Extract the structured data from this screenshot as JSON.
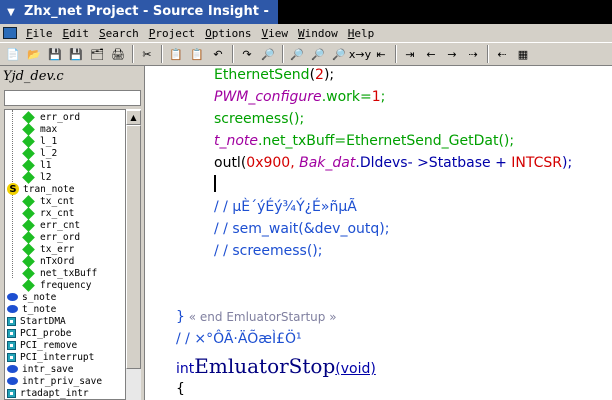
{
  "window": {
    "title": "Zhx_net Project - Source Insight -",
    "system_icon": "system-menu-icon"
  },
  "menu": [
    "File",
    "Edit",
    "Search",
    "Project",
    "Options",
    "View",
    "Window",
    "Help"
  ],
  "toolbar": [
    {
      "name": "new-file-icon",
      "glyph": "📄"
    },
    {
      "name": "open-folder-icon",
      "glyph": "📂"
    },
    {
      "name": "save-icon",
      "glyph": "💾"
    },
    {
      "name": "save-all-icon",
      "glyph": "💾"
    },
    {
      "name": "close-file-icon",
      "glyph": "🗂"
    },
    {
      "name": "print-icon",
      "glyph": "🖨"
    },
    {
      "name": "cut-icon",
      "glyph": "✂"
    },
    {
      "name": "copy-icon",
      "glyph": "📋"
    },
    {
      "name": "paste-icon",
      "glyph": "📋"
    },
    {
      "name": "undo-icon",
      "glyph": "↶"
    },
    {
      "name": "redo-icon",
      "glyph": "↷"
    },
    {
      "name": "search-icon",
      "glyph": "🔎"
    },
    {
      "name": "search-files-icon",
      "glyph": "🔎"
    },
    {
      "name": "search-project-icon",
      "glyph": "🔎"
    },
    {
      "name": "replace-icon",
      "glyph": "🔎"
    },
    {
      "name": "lookup-icon",
      "glyph": "x→y"
    },
    {
      "name": "jump-left-icon",
      "glyph": "⇤"
    },
    {
      "name": "jump-right-icon",
      "glyph": "⇥"
    },
    {
      "name": "back-icon",
      "glyph": "←"
    },
    {
      "name": "forward-icon",
      "glyph": "→"
    },
    {
      "name": "next-link-icon",
      "glyph": "⇢"
    },
    {
      "name": "prev-link-icon",
      "glyph": "⇠"
    },
    {
      "name": "relation-window-icon",
      "glyph": "▦"
    }
  ],
  "left_panel": {
    "file_label": "Yjd_dev.c",
    "filter_value": "",
    "items": [
      {
        "label": "err_ord",
        "icon": "diamond",
        "indent": 2
      },
      {
        "label": "max",
        "icon": "diamond",
        "indent": 2
      },
      {
        "label": "l_1",
        "icon": "diamond",
        "indent": 2
      },
      {
        "label": "l_2",
        "icon": "diamond",
        "indent": 2
      },
      {
        "label": "l1",
        "icon": "diamond",
        "indent": 2
      },
      {
        "label": "l2",
        "icon": "diamond",
        "indent": 2
      },
      {
        "label": "tran_note",
        "icon": "struct",
        "indent": 0
      },
      {
        "label": "tx_cnt",
        "icon": "diamond",
        "indent": 2
      },
      {
        "label": "rx_cnt",
        "icon": "diamond",
        "indent": 2
      },
      {
        "label": "err_cnt",
        "icon": "diamond",
        "indent": 2
      },
      {
        "label": "err_ord",
        "icon": "diamond",
        "indent": 2
      },
      {
        "label": "tx_err",
        "icon": "diamond",
        "indent": 2
      },
      {
        "label": "nTxOrd",
        "icon": "diamond",
        "indent": 2
      },
      {
        "label": "net_txBuff",
        "icon": "diamond",
        "indent": 2
      },
      {
        "label": "frequency",
        "icon": "diamond",
        "indent": 2
      },
      {
        "label": "s_note",
        "icon": "oval",
        "indent": 0
      },
      {
        "label": "t_note",
        "icon": "oval",
        "indent": 0
      },
      {
        "label": "StartDMA",
        "icon": "func",
        "indent": 0
      },
      {
        "label": "PCI_probe",
        "icon": "func",
        "indent": 0
      },
      {
        "label": "PCI_remove",
        "icon": "func",
        "indent": 0
      },
      {
        "label": "PCI_interrupt",
        "icon": "func",
        "indent": 0
      },
      {
        "label": "intr_save",
        "icon": "oval",
        "indent": 0
      },
      {
        "label": "intr_priv_save",
        "icon": "oval",
        "indent": 0
      },
      {
        "label": "rtadapt_intr",
        "icon": "func",
        "indent": 0
      }
    ]
  },
  "code": {
    "line1": {
      "fn": "EthernetSend",
      "open": "(",
      "arg": "2",
      "close": ");"
    },
    "line2": {
      "obj": "PWM_configure",
      "member": ".work=",
      "num": "1",
      "end": ";"
    },
    "line3": {
      "fn": "screemess",
      "rest": "();"
    },
    "line4": {
      "obj": "t_note",
      "member": ".net_txBuff=",
      "fn": "EthernetSend_GetDat",
      "end": "();"
    },
    "line5": {
      "fn": "outl",
      "open": "(",
      "num": "0x900,",
      "obj": "Bak_dat",
      "member": ".Dldevs- >Statbase + ",
      "macro": "INTCSR",
      "end": ");"
    },
    "comment1": "/ / µÈ´ýÉý¾Ý¿É»ñµÃ",
    "comment2": "/ / sem_wait(&dev_outq);",
    "comment3": "/ / screemess();",
    "brace_close": "}",
    "end_marker": " « end EmluatorStartup »",
    "comment4": "/ / ×°ÔÃ·ÄÕæÌ£Ö¹",
    "decl_type": "int",
    "decl_name": "EmluatorStop",
    "decl_args": "(void)",
    "brace_open": "{"
  }
}
